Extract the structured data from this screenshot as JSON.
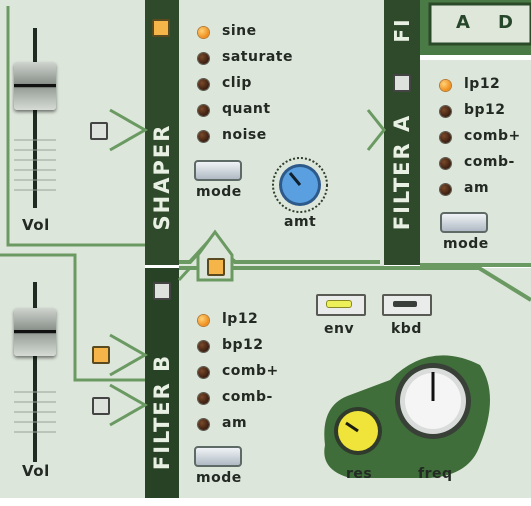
{
  "colors": {
    "panel": "#dce5da",
    "strip": "#6a9a62",
    "dark_strip": "#264024",
    "led_on": "#f5a030",
    "knob_amt": "#4a8fd0",
    "knob_res": "#f2e640"
  },
  "volume_left": {
    "top_label": "Vol",
    "bottom_label": "Vol"
  },
  "shaper": {
    "title": "SHAPER",
    "modes": [
      "sine",
      "saturate",
      "clip",
      "quant",
      "noise"
    ],
    "active_index": 0,
    "mode_label": "mode",
    "knob_label": "amt"
  },
  "filter_a": {
    "title": "FILTER A",
    "modes": [
      "lp12",
      "bp12",
      "comb+",
      "comb-",
      "am"
    ],
    "active_index": 0,
    "mode_label": "mode"
  },
  "filter_b": {
    "title": "FILTER B",
    "modes": [
      "lp12",
      "bp12",
      "comb+",
      "comb-",
      "am"
    ],
    "active_index": 0,
    "mode_label": "mode",
    "env_label": "env",
    "kbd_label": "kbd",
    "res_label": "res",
    "freq_label": "freq"
  },
  "top_strip": {
    "label": "FI",
    "display": [
      "A",
      "D"
    ]
  },
  "icons": [
    "orange-led-icon",
    "dark-led-icon",
    "square-toggle-icon",
    "triangle-arrow-icon",
    "knob-icon",
    "fader-handle-icon"
  ]
}
